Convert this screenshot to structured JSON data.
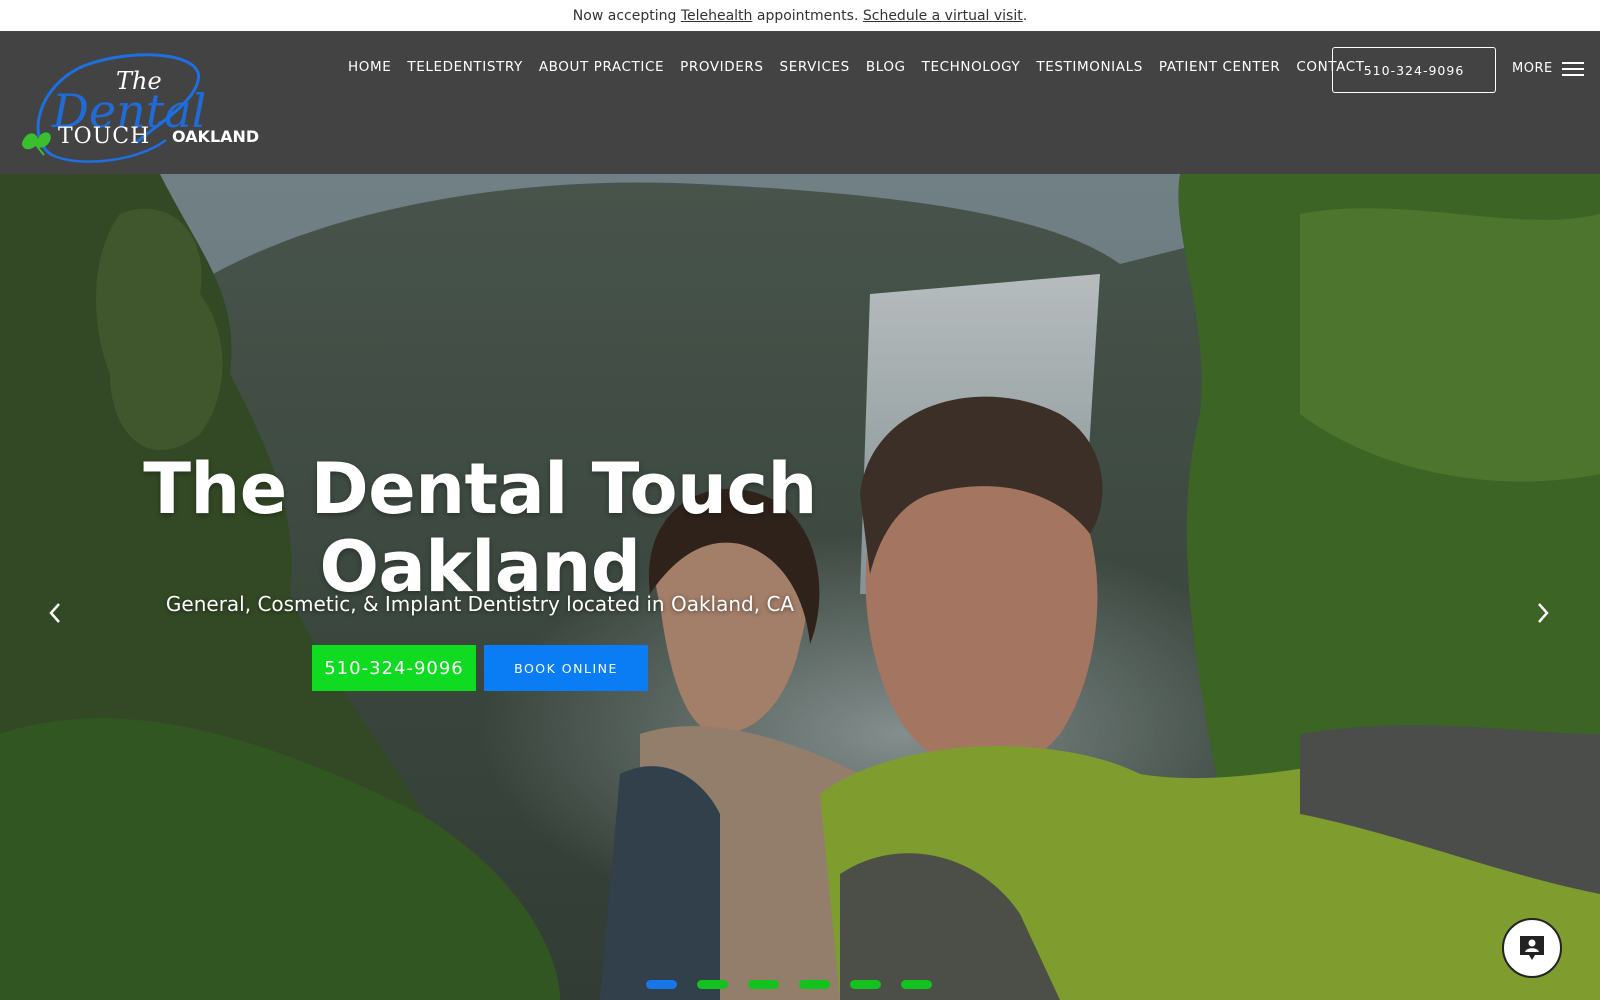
{
  "announcement": {
    "prefix": "Now accepting ",
    "link1": "Telehealth",
    "middle": " appointments. ",
    "link2": "Schedule a virtual visit",
    "suffix": "."
  },
  "logo": {
    "script_the": "The",
    "script_dental": "Dental",
    "word_touch": "TOUCH",
    "location": "OAKLAND",
    "brand_blue": "#1e6fe0",
    "leaf_green": "#3bbf2f"
  },
  "nav": {
    "items": [
      {
        "label": "HOME"
      },
      {
        "label": "TELEDENTISTRY"
      },
      {
        "label": "ABOUT PRACTICE"
      },
      {
        "label": "PROVIDERS"
      },
      {
        "label": "SERVICES"
      },
      {
        "label": "BLOG"
      },
      {
        "label": "TECHNOLOGY"
      },
      {
        "label": "TESTIMONIALS"
      },
      {
        "label": "PATIENT CENTER"
      },
      {
        "label": "CONTACT"
      }
    ],
    "phone": "510-324-9096",
    "more_label": "MORE",
    "more_icon": "hamburger-menu-icon"
  },
  "hero": {
    "title_line1": "The Dental Touch",
    "title_line2": "Oakland",
    "subtitle": "General, Cosmetic, & Implant Dentistry located in Oakland, CA",
    "cta_phone": "510-324-9096",
    "cta_book": "BOOK ONLINE",
    "prev_icon": "chevron-left-icon",
    "next_icon": "chevron-right-icon",
    "slides_count": 6,
    "active_slide": 1,
    "active_dot_color": "#1877e6",
    "dot_color": "#13c21c"
  },
  "chat": {
    "icon": "chat-person-icon"
  },
  "colors": {
    "header_bg": "#434343",
    "cta_green": "#0fdc21",
    "cta_blue": "#0a7cf4"
  }
}
